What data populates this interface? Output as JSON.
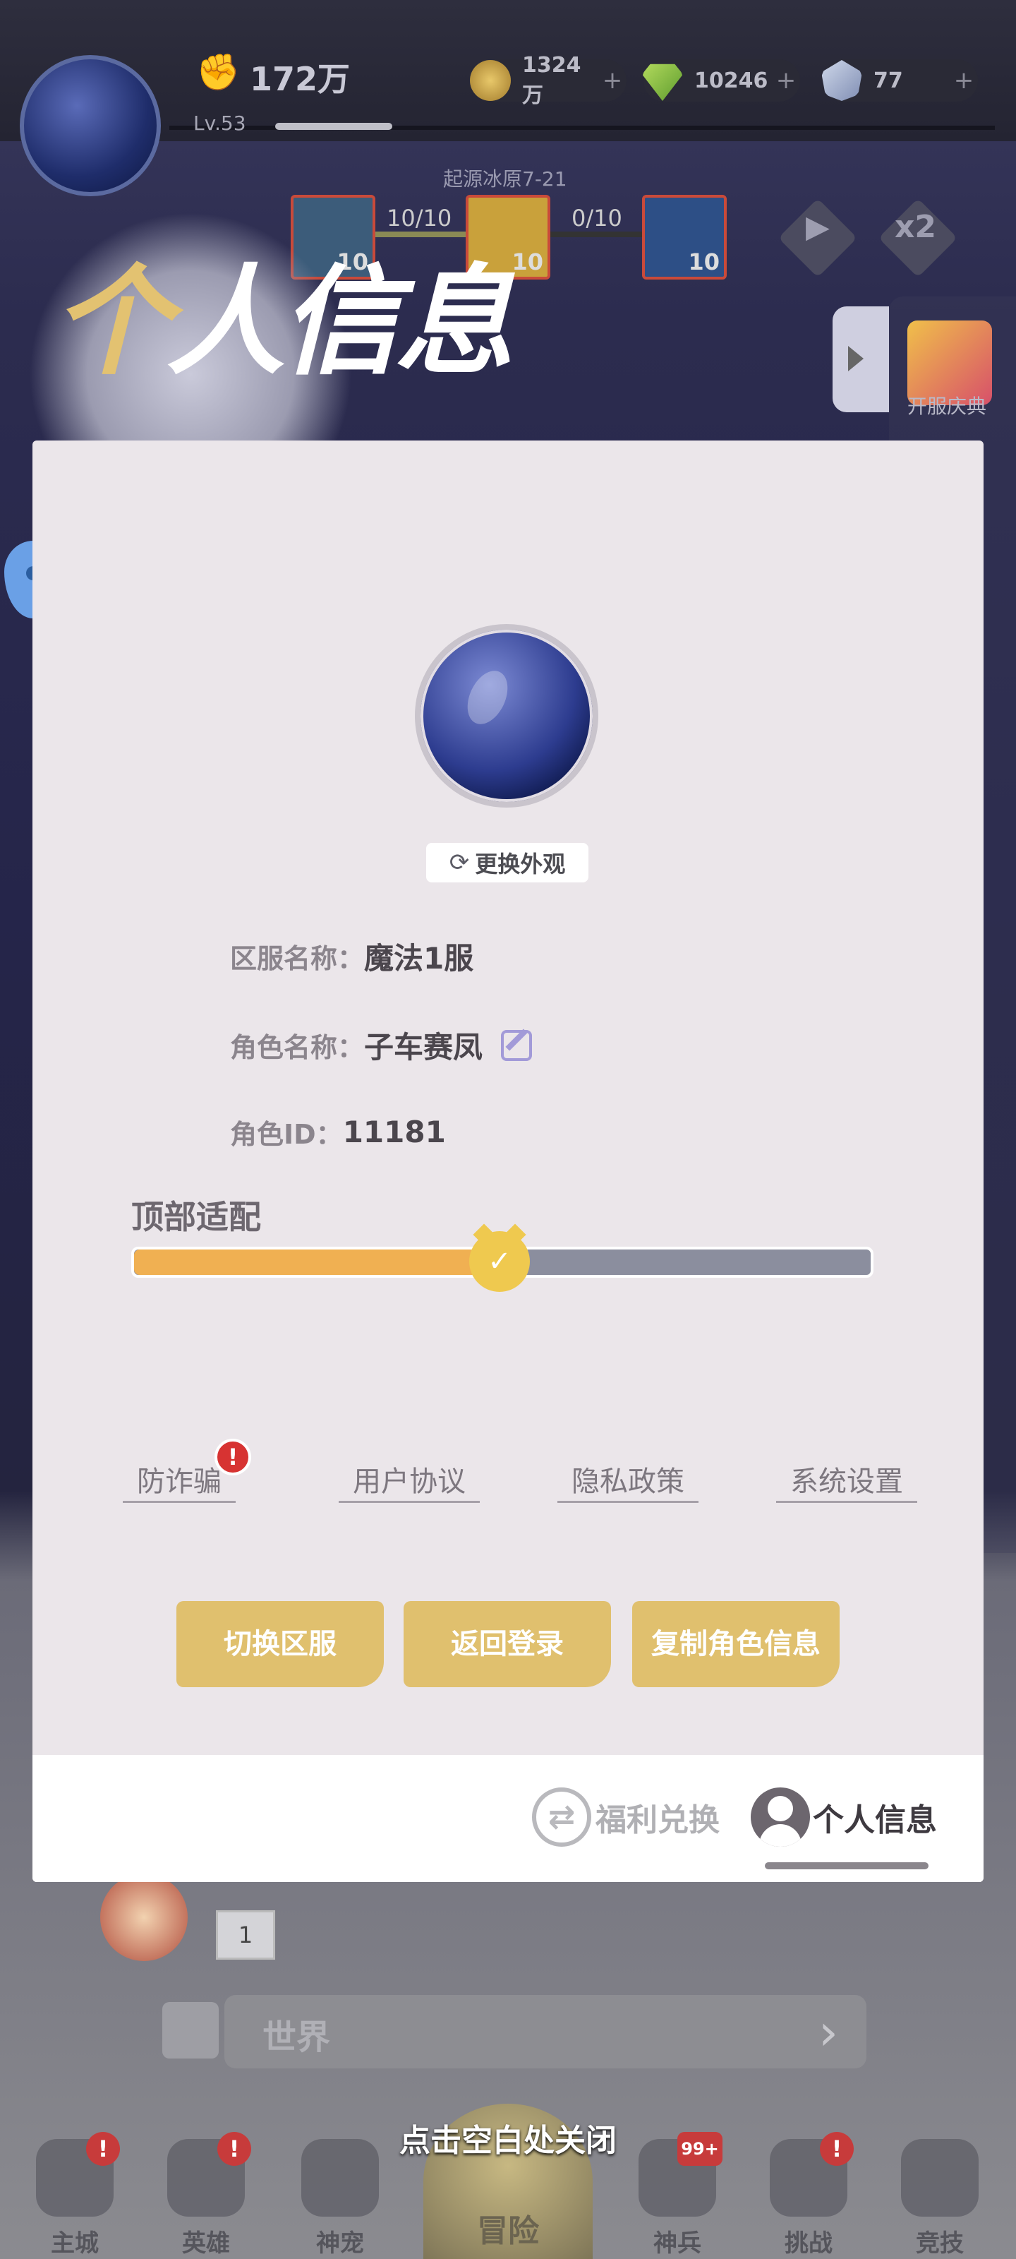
{
  "topbar": {
    "power": "172万",
    "level": "Lv.53",
    "gold": "1324万",
    "gems": "10246",
    "crystals": "77",
    "plus": "+"
  },
  "stage": {
    "name": "起源冰原7-21",
    "progress_left": "10/10",
    "progress_right": "0/10",
    "card_count": "10"
  },
  "side": {
    "open_celebration": "开服庆典"
  },
  "overlay_title": {
    "first_char": "个",
    "rest": "人信息"
  },
  "profile": {
    "change_look": "更换外观",
    "server_label": "区服名称：",
    "server_value": "魔法1服",
    "role_label": "角色名称：",
    "role_value": "子车赛凤",
    "id_label": "角色ID：",
    "id_value": "11181",
    "top_adapt_label": "顶部适配",
    "top_adapt_fraction": 0.5
  },
  "links": {
    "antifraud": "防诈骗",
    "antifraud_badge": "!",
    "user_agreement": "用户协议",
    "privacy_policy": "隐私政策",
    "system_settings": "系统设置"
  },
  "actions": {
    "switch_server": "切换区服",
    "back_to_login": "返回登录",
    "copy_role_info": "复制角色信息"
  },
  "tabs": {
    "exchange": "福利兑换",
    "profile": "个人信息"
  },
  "chat": {
    "count": "1",
    "channel": "世界"
  },
  "close_hint": "点击空白处关闭",
  "nav": {
    "main_city": "主城",
    "hero": "英雄",
    "pet": "神宠",
    "adventure": "冒险",
    "weapon": "神兵",
    "weapon_badge": "99+",
    "challenge": "挑战",
    "arena": "竞技",
    "badge": "!"
  },
  "colors": {
    "accent_gold": "#e0c06e",
    "slider_fill": "#f0b052",
    "badge_red": "#d73332"
  }
}
